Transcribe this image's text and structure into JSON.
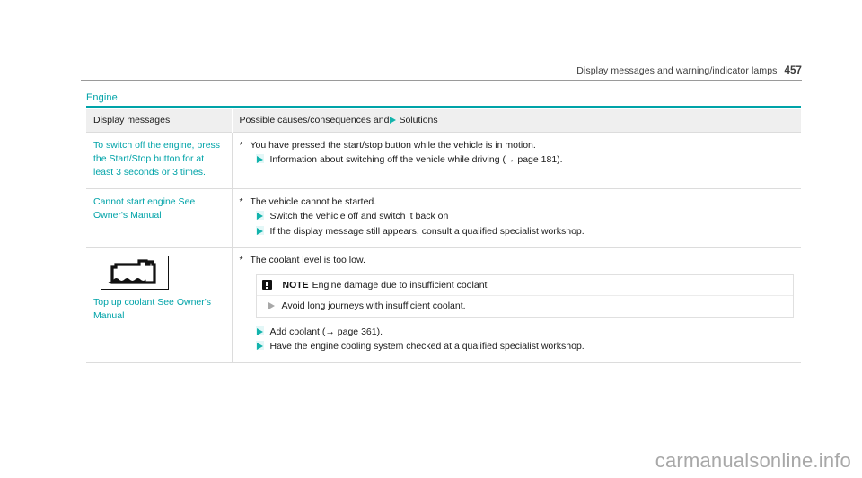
{
  "running_head": {
    "title": "Display messages and warning/indicator lamps",
    "page_number": "457"
  },
  "section": {
    "title": "Engine"
  },
  "colors": {
    "accent_teal": "#00a3a8",
    "marker_teal": "#12b3ac",
    "header_gray": "#efefef",
    "rule_gray": "#9a9a9a",
    "border_gray": "#dcdcdc",
    "watermark_gray": "#a8a8a8"
  },
  "table": {
    "headers": {
      "col1": "Display messages",
      "col2_pre": "Possible causes/consequences and",
      "col2_marker": "solution-triangle-icon",
      "col2_post": "Solutions"
    },
    "rows": [
      {
        "message": "To switch off the engine, press the Start/Stop button for at least 3 seconds or 3 times.",
        "cause": "You have pressed the start/stop button while the vehicle is in motion.",
        "cause_marker": "*",
        "solutions": [
          "Information about switching off the vehicle while driving (→ page 181)."
        ]
      },
      {
        "message": "Cannot start engine See Owner's Manual",
        "cause": "The vehicle cannot be started.",
        "cause_marker": "*",
        "solutions": [
          "Switch the vehicle off and switch it back on",
          "If the display message still appears, consult a qualified specialist workshop."
        ]
      },
      {
        "icon": "coolant-reservoir-icon",
        "message": "Top up coolant See Owner's Manual",
        "cause": "The coolant level is too low.",
        "cause_marker": "*",
        "note": {
          "icon": "exclamation-box-icon",
          "label": "NOTE",
          "title": "Engine damage due to insufficient coolant",
          "bullet": "Avoid long journeys with insufficient coolant."
        },
        "solutions": [
          "Add coolant (→ page 361).",
          "Have the engine cooling system checked at a qualified specialist workshop."
        ]
      }
    ]
  },
  "watermark": {
    "text": "carmanualsonline.info"
  }
}
